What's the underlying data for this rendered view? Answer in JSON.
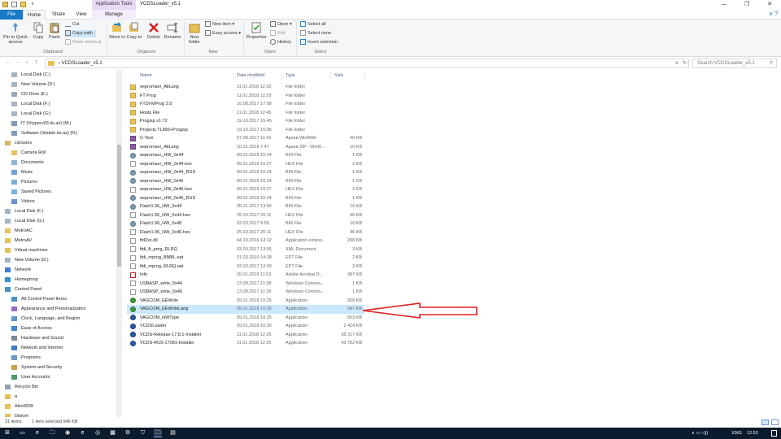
{
  "titlebar": {
    "context_tab": "Application Tools",
    "title": "VCDSLoader_v5.1",
    "qa_caret": "∨",
    "min": "—",
    "max": "❐",
    "close": "✕"
  },
  "tabs": {
    "file": "File",
    "home": "Home",
    "share": "Share",
    "view": "View",
    "manage": "Manage",
    "help": "∨  ?"
  },
  "ribbon": {
    "pin_label": "Pin to Quick access",
    "copy_label": "Copy",
    "paste_label": "Paste",
    "cut_label": "Cut",
    "copy_path_label": "Copy path",
    "paste_shortcut_label": "Paste shortcut",
    "clipboard_group": "Clipboard",
    "move_to_label": "Move to",
    "copy_to_label": "Copy to",
    "delete_label": "Delete",
    "rename_label": "Rename",
    "organize_group": "Organize",
    "new_folder_label": "New folder",
    "new_item_label": "New item ▾",
    "easy_access_label": "Easy access ▾",
    "new_group": "New",
    "properties_label": "Properties",
    "open_label": "Open ▾",
    "edit_label": "Edit",
    "history_label": "History",
    "open_group": "Open",
    "select_all_label": "Select all",
    "select_none_label": "Select none",
    "invert_selection_label": "Invert selection",
    "select_group": "Select"
  },
  "address": {
    "back": "←",
    "forward": "→",
    "recent": "∨",
    "up": "↑",
    "path": "›  VCDSLoader_v5.1",
    "caret": "∨",
    "refresh": "↻",
    "search_placeholder": "Search VCDSLoader_v5.1",
    "search_icon": "⚲"
  },
  "nav": {
    "items": [
      {
        "label": "Local Disk (C:)",
        "icon": "drive-icon"
      },
      {
        "label": "New Volume (D:)",
        "icon": "drive-icon"
      },
      {
        "label": "CD Drive (E:)",
        "icon": "cd-drive-icon"
      },
      {
        "label": "Local Disk (F:)",
        "icon": "drive-icon"
      },
      {
        "label": "Local Disk (G:)",
        "icon": "drive-icon"
      },
      {
        "label": "IT (\\\\hyperv03.its.az) (M:)",
        "icon": "network-drive-icon"
      },
      {
        "label": "Software (\\\\itsbdc.its.az) (N:)",
        "icon": "network-drive-icon"
      },
      {
        "label": "Libraries",
        "icon": "library-icon"
      },
      {
        "label": "Camera Roll",
        "icon": "library-folder-icon"
      },
      {
        "label": "Documents",
        "icon": "documents-icon"
      },
      {
        "label": "Music",
        "icon": "music-icon"
      },
      {
        "label": "Pictures",
        "icon": "pictures-icon"
      },
      {
        "label": "Saved Pictures",
        "icon": "pictures-icon"
      },
      {
        "label": "Videos",
        "icon": "videos-icon"
      },
      {
        "label": "Local Disk (F:)",
        "icon": "drive-icon"
      },
      {
        "label": "Local Disk (G:)",
        "icon": "drive-icon"
      },
      {
        "label": "MetroAC",
        "icon": "folder-icon"
      },
      {
        "label": "MetroAV",
        "icon": "folder-icon"
      },
      {
        "label": "Virtual machines",
        "icon": "folder-icon"
      },
      {
        "label": "New Volume (D:)",
        "icon": "drive-icon"
      },
      {
        "label": "Network",
        "icon": "network-icon"
      },
      {
        "label": "Homegroup",
        "icon": "homegroup-icon"
      },
      {
        "label": "Control Panel",
        "icon": "control-panel-icon"
      },
      {
        "label": "All Control Panel Items",
        "icon": "control-panel-icon"
      },
      {
        "label": "Appearance and Personalization",
        "icon": "appearance-icon"
      },
      {
        "label": "Clock, Language, and Region",
        "icon": "clock-icon"
      },
      {
        "label": "Ease of Access",
        "icon": "ease-access-icon"
      },
      {
        "label": "Hardware and Sound",
        "icon": "hardware-icon"
      },
      {
        "label": "Network and Internet",
        "icon": "network-icon"
      },
      {
        "label": "Programs",
        "icon": "programs-icon"
      },
      {
        "label": "System and Security",
        "icon": "security-icon"
      },
      {
        "label": "User Accounts",
        "icon": "user-icon"
      },
      {
        "label": "Recycle Bin",
        "icon": "recycle-bin-icon"
      },
      {
        "label": "a",
        "icon": "folder-icon"
      },
      {
        "label": "Alex6599",
        "icon": "folder-icon"
      },
      {
        "label": "Diplom",
        "icon": "folder-icon"
      }
    ]
  },
  "columns": {
    "name": "Name",
    "date": "Date modified",
    "type": "Type",
    "size": "Size"
  },
  "files": [
    {
      "name": "eepromavr_AllLang",
      "date": "11.01.2018 12:30",
      "type": "File folder",
      "size": "",
      "icon": "folder"
    },
    {
      "name": "FT Prog",
      "date": "11.01.2018 12:29",
      "type": "File folder",
      "size": "",
      "icon": "folder"
    },
    {
      "name": "FTDI-MProg 3.5",
      "date": "16.08.2017 17:08",
      "type": "File folder",
      "size": "",
      "icon": "folder"
    },
    {
      "name": "Hosts File",
      "date": "11.01.2018 12:45",
      "type": "File folder",
      "size": "",
      "icon": "folder"
    },
    {
      "name": "Progisp v1.72",
      "date": "19.10.2017 15:45",
      "type": "File folder",
      "size": "",
      "icon": "folder"
    },
    {
      "name": "Projects TL866+Progisp",
      "date": "19.10.2017 15:06",
      "type": "File folder",
      "size": "",
      "icon": "folder"
    },
    {
      "name": "C-Test",
      "date": "07.08.2017 11:42",
      "type": "Архив WinRAR",
      "size": "40 KB",
      "icon": "archive"
    },
    {
      "name": "eepromavr_AllLang",
      "date": "10.01.2018 7:47",
      "type": "Архив ZIP - WinR...",
      "size": "10 KB",
      "icon": "archive"
    },
    {
      "name": "eepromavr_HW_0x44",
      "date": "09.01.2018 10:24",
      "type": "BIN File",
      "size": "1 KB",
      "icon": "app"
    },
    {
      "name": "eepromavr_HW_0x44.hex",
      "date": "09.01.2018 10:27",
      "type": "HEX File",
      "size": "2 KB",
      "icon": "file"
    },
    {
      "name": "eepromavr_HW_0x44_RUS",
      "date": "09.01.2018 10:24",
      "type": "BIN File",
      "size": "1 KB",
      "icon": "app"
    },
    {
      "name": "eepromavr_HW_0x46",
      "date": "09.01.2018 10:24",
      "type": "BIN File",
      "size": "1 KB",
      "icon": "app"
    },
    {
      "name": "eepromavr_HW_0x46.hex",
      "date": "09.01.2018 10:27",
      "type": "HEX File",
      "size": "2 KB",
      "icon": "file"
    },
    {
      "name": "eepromavr_HW_0x46_RUS",
      "date": "09.01.2018 10:24",
      "type": "BIN File",
      "size": "1 KB",
      "icon": "app"
    },
    {
      "name": "Flash1.96_HW_0x44",
      "date": "05.01.2017 13:56",
      "type": "BIN File",
      "size": "16 KB",
      "icon": "app"
    },
    {
      "name": "Flash1.96_HW_0x44.hex",
      "date": "25.03.2017 20:11",
      "type": "HEX File",
      "size": "46 KB",
      "icon": "file"
    },
    {
      "name": "Flash1.96_HW_0x46",
      "date": "03.03.2017 8:56",
      "type": "BIN File",
      "size": "16 KB",
      "icon": "app"
    },
    {
      "name": "Flash1.96_HW_0x46.hex",
      "date": "25.03.2017 20:11",
      "type": "HEX File",
      "size": "46 KB",
      "icon": "file"
    },
    {
      "name": "ftd2xx.dll",
      "date": "04.10.2016 14:12",
      "type": "Application extens...",
      "size": "268 KB",
      "icon": "dll"
    },
    {
      "name": "ftdi_ft_prog_RLRQ",
      "date": "03.03.2017 13:05",
      "type": "XML Document",
      "size": "3 KB",
      "icon": "file"
    },
    {
      "name": "ftdi_mprog_BMBL.ept",
      "date": "01.03.2010 14:28",
      "type": "EPT File",
      "size": "2 KB",
      "icon": "file"
    },
    {
      "name": "ftdi_mprog_RLRQ.ept",
      "date": "03.03.2017 13:09",
      "type": "EPT File",
      "size": "2 KB",
      "icon": "file"
    },
    {
      "name": "Info",
      "date": "05.01.2018 11:53",
      "type": "Adobe Acrobat D...",
      "size": "387 KB",
      "icon": "pdf"
    },
    {
      "name": "USBASP_write_0x44",
      "date": "13.08.2017 11:38",
      "type": "Windows Comma...",
      "size": "1 KB",
      "icon": "file"
    },
    {
      "name": "USBASP_write_0x46",
      "date": "13.08.2017 11:39",
      "type": "Windows Comma...",
      "size": "1 KB",
      "icon": "file"
    },
    {
      "name": "VAGCOM_EEWrite",
      "date": "09.01.2018 10:25",
      "type": "Application",
      "size": "928 KB",
      "icon": "exe"
    },
    {
      "name": "VAGCOM_EEWriteLang",
      "date": "09.01.2018 10:25",
      "type": "Application",
      "size": "947 KB",
      "icon": "exe",
      "selected": true
    },
    {
      "name": "VAGCOM_HWType",
      "date": "09.01.2018 10:25",
      "type": "Application",
      "size": "603 KB",
      "icon": "vcds"
    },
    {
      "name": "VCDSLoader",
      "date": "09.01.2018 10:26",
      "type": "Application",
      "size": "2 424 KB",
      "icon": "vcds"
    },
    {
      "name": "VCDS-Release-17.8.1-Installer",
      "date": "11.01.2018 12:25",
      "type": "Application",
      "size": "38 317 KB",
      "icon": "vcds"
    },
    {
      "name": "VCDS-RUS-17081-Installer",
      "date": "11.01.2018 12:25",
      "type": "Application",
      "size": "43 752 KB",
      "icon": "vcds"
    }
  ],
  "status": {
    "count": "31 items",
    "selection": "1 item selected  946 KB"
  },
  "taskbar": {
    "lang": "ENG",
    "time": "12:52",
    "tray": "∧  ▭  ◁))",
    "taskbar_icons": [
      "start-icon",
      "task-view-icon",
      "edge-icon",
      "explorer-icon",
      "xbox-icon",
      "ie-icon",
      "chrome-icon",
      "vcds-icon",
      "settings-icon",
      "teamviewer-icon",
      "file-explorer-icon",
      "calc-icon"
    ],
    "taskbar_glyphs": [
      "⊞",
      "▭",
      "e",
      "🗀",
      "◉",
      "e",
      "◎",
      "▦",
      "⚙",
      "⛉",
      "🗀",
      "▤"
    ]
  },
  "colors": {
    "accent": "#1979ca",
    "selection": "#cce8ff",
    "arrow": "#e02020",
    "context_tab": "#e8d9f5"
  }
}
